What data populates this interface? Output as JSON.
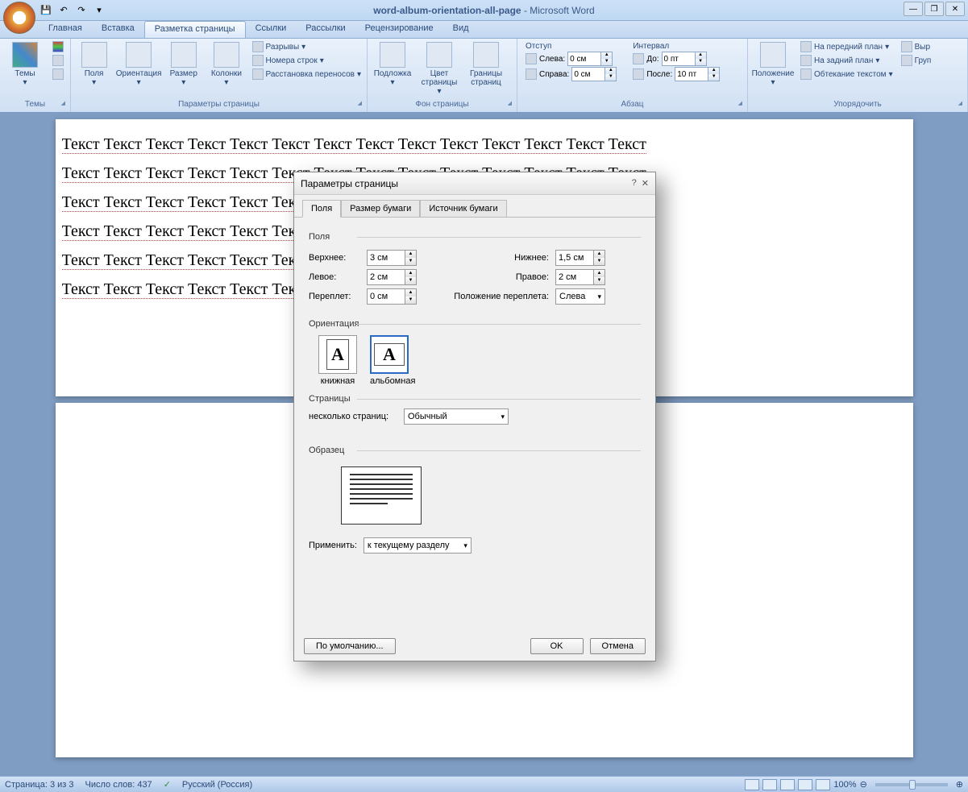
{
  "window": {
    "doc_name": "word-album-orientation-all-page",
    "app_suffix": " - Microsoft Word"
  },
  "tabs": {
    "home": "Главная",
    "insert": "Вставка",
    "layout": "Разметка страницы",
    "refs": "Ссылки",
    "mail": "Рассылки",
    "review": "Рецензирование",
    "view": "Вид"
  },
  "ribbon": {
    "themes": {
      "label": "Темы",
      "themes_btn": "Темы"
    },
    "page_setup": {
      "label": "Параметры страницы",
      "margins": "Поля",
      "orientation": "Ориентация",
      "size": "Размер",
      "columns": "Колонки",
      "breaks": "Разрывы",
      "line_numbers": "Номера строк",
      "hyphenation": "Расстановка переносов"
    },
    "page_bg": {
      "label": "Фон страницы",
      "watermark": "Подложка",
      "color": "Цвет страницы",
      "borders": "Границы страниц"
    },
    "paragraph": {
      "label": "Абзац",
      "indent": "Отступ",
      "left": "Слева:",
      "right": "Справа:",
      "left_val": "0 см",
      "right_val": "0 см",
      "spacing": "Интервал",
      "before": "До:",
      "after": "После:",
      "before_val": "0 пт",
      "after_val": "10 пт"
    },
    "arrange": {
      "label": "Упорядочить",
      "position": "Положение",
      "front": "На передний план",
      "back": "На задний план",
      "wrap": "Обтекание текстом",
      "align": "Выр",
      "group": "Груп"
    }
  },
  "doc": {
    "word": "Текст"
  },
  "dialog": {
    "title": "Параметры страницы",
    "tabs": {
      "margins": "Поля",
      "paper": "Размер бумаги",
      "source": "Источник бумаги"
    },
    "margins_section": "Поля",
    "top": "Верхнее:",
    "top_val": "3 см",
    "bottom": "Нижнее:",
    "bottom_val": "1,5 см",
    "left": "Левое:",
    "left_val": "2 см",
    "right": "Правое:",
    "right_val": "2 см",
    "gutter": "Переплет:",
    "gutter_val": "0 см",
    "gutter_pos": "Положение переплета:",
    "gutter_pos_val": "Слева",
    "orientation": "Ориентация",
    "portrait": "книжная",
    "landscape": "альбомная",
    "pages": "Страницы",
    "multi_pages": "несколько страниц:",
    "multi_val": "Обычный",
    "preview": "Образец",
    "apply": "Применить:",
    "apply_val": "к текущему разделу",
    "default": "По умолчанию...",
    "ok": "OK",
    "cancel": "Отмена"
  },
  "status": {
    "page": "Страница: 3 из 3",
    "words": "Число слов: 437",
    "lang": "Русский (Россия)",
    "zoom": "100%"
  }
}
